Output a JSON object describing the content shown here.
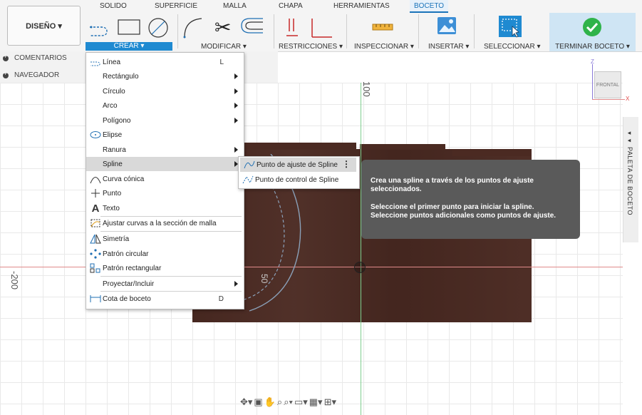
{
  "tabs": [
    "SOLIDO",
    "SUPERFICIE",
    "MALLA",
    "CHAPA",
    "HERRAMIENTAS",
    "BOCETO"
  ],
  "design_button": "DISEÑO ▾",
  "groups": {
    "crear": "CREAR ▾",
    "modificar": "MODIFICAR ▾",
    "restricciones": "RESTRICCIONES ▾",
    "inspeccionar": "INSPECCIONAR ▾",
    "insertar": "INSERTAR ▾",
    "seleccionar": "SELECCIONAR ▾",
    "terminar": "TERMINAR BOCETO ▾"
  },
  "left_panel": {
    "comentarios": "COMENTARIOS",
    "navegador": "NAVEGADOR"
  },
  "menu": [
    {
      "label": "Línea",
      "shortcut": "L"
    },
    {
      "label": "Rectángulo"
    },
    {
      "label": "Círculo"
    },
    {
      "label": "Arco"
    },
    {
      "label": "Polígono"
    },
    {
      "label": "Elipse"
    },
    {
      "label": "Ranura"
    },
    {
      "label": "Spline"
    },
    {
      "label": "Curva cónica"
    },
    {
      "label": "Punto"
    },
    {
      "label": "Texto"
    },
    {
      "label": "Ajustar curvas a la sección de malla"
    },
    {
      "label": "Simetría"
    },
    {
      "label": "Patrón circular"
    },
    {
      "label": "Patrón rectangular"
    },
    {
      "label": "Proyectar/Incluir"
    },
    {
      "label": "Cota de boceto",
      "shortcut": "D"
    }
  ],
  "submenu": [
    "Punto de ajuste de Spline",
    "Punto de control de Spline"
  ],
  "tooltip": {
    "p1": "Crea una spline a través de los puntos de ajuste seleccionados.",
    "p2": "Seleccione el primer punto para iniciar la spline. Seleccione puntos adicionales como puntos de ajuste."
  },
  "palette": "◂◂ PALETA DE BOCETO",
  "viewcube": {
    "label": "FRONTAL",
    "z": "Z",
    "x": "X"
  },
  "axis_labels": {
    "top": "100",
    "left": "-200",
    "mid": "50"
  },
  "colors": {
    "accent": "#1f8ad1",
    "wood": "#4b2a22",
    "tooltip": "#5a5a5a",
    "finish": "#2fb34a"
  }
}
